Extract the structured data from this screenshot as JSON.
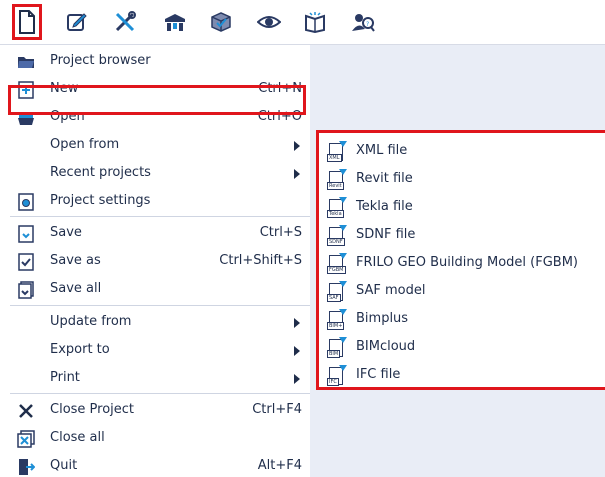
{
  "toolbar": {
    "buttons": [
      {
        "icon": "file-icon",
        "name": "file-button"
      },
      {
        "icon": "edit-icon",
        "name": "edit-button"
      },
      {
        "icon": "tools-icon",
        "name": "tools-button"
      },
      {
        "icon": "structure-icon",
        "name": "structure-button"
      },
      {
        "icon": "cube-icon",
        "name": "cube-button"
      },
      {
        "icon": "eye-icon",
        "name": "view-button"
      },
      {
        "icon": "book-icon",
        "name": "book-button"
      },
      {
        "icon": "search-person-icon",
        "name": "search-button"
      }
    ]
  },
  "menu": {
    "project_browser": {
      "label": "Project browser",
      "icon": "folder-icon"
    },
    "new": {
      "label": "New",
      "shortcut": "Ctrl+N",
      "icon": "new-file-icon"
    },
    "open": {
      "label": "Open",
      "shortcut": "Ctrl+O",
      "icon": "open-folder-icon"
    },
    "open_from": {
      "label": "Open from"
    },
    "recent_projects": {
      "label": "Recent projects"
    },
    "project_settings": {
      "label": "Project settings",
      "icon": "settings-icon"
    },
    "save": {
      "label": "Save",
      "shortcut": "Ctrl+S",
      "icon": "save-icon"
    },
    "save_as": {
      "label": "Save as",
      "shortcut": "Ctrl+Shift+S",
      "icon": "save-as-icon"
    },
    "save_all": {
      "label": "Save all",
      "icon": "save-all-icon"
    },
    "update_from": {
      "label": "Update from"
    },
    "export_to": {
      "label": "Export to"
    },
    "print": {
      "label": "Print"
    },
    "close_project": {
      "label": "Close Project",
      "shortcut": "Ctrl+F4",
      "icon": "close-icon"
    },
    "close_all": {
      "label": "Close all",
      "icon": "close-all-icon"
    },
    "quit": {
      "label": "Quit",
      "shortcut": "Alt+F4",
      "icon": "quit-icon"
    }
  },
  "submenu": {
    "items": [
      {
        "label": "XML file",
        "tag": "XML"
      },
      {
        "label": "Revit file",
        "tag": "Revit"
      },
      {
        "label": "Tekla file",
        "tag": "Tekla"
      },
      {
        "label": "SDNF file",
        "tag": "SDNF"
      },
      {
        "label": "FRILO GEO Building Model (FGBM)",
        "tag": "FGBM"
      },
      {
        "label": "SAF model",
        "tag": "SAF"
      },
      {
        "label": "Bimplus",
        "tag": "BIM+"
      },
      {
        "label": "BIMcloud",
        "tag": "BIM"
      },
      {
        "label": "IFC file",
        "tag": "IFC"
      }
    ]
  },
  "colors": {
    "highlight": "#e0161c",
    "accent": "#1e8fd6",
    "text": "#1f2d4a",
    "background_right": "#e9edf6"
  }
}
